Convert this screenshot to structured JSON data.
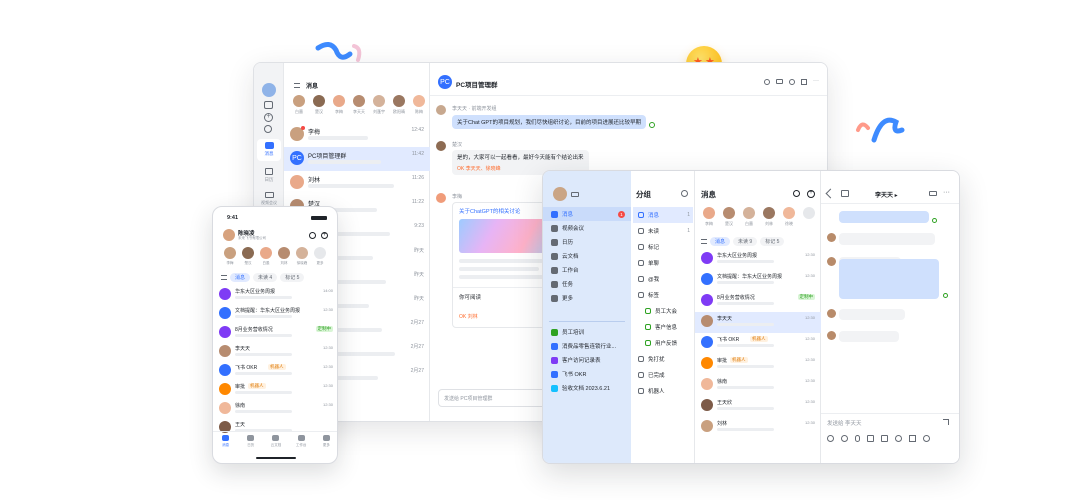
{
  "colors": {
    "accent": "#3370ff",
    "green": "#2ea121",
    "orange": "#ff8800",
    "red": "#f54a45",
    "purple": "#7f3bf5",
    "teal": "#14c0ff"
  },
  "desktop": {
    "rail": {
      "items": [
        {
          "label": "消息"
        },
        {
          "label": "日历"
        },
        {
          "label": "视频会议"
        }
      ]
    },
    "list": {
      "title": "消息",
      "top_avatars": [
        "白墨",
        "楚汉",
        "李梅",
        "李天天",
        "刘蓬宇",
        "欧阳晴",
        "陈梅"
      ],
      "items": [
        {
          "name": "李梅",
          "time": "12:42"
        },
        {
          "name": "PC项目管理群",
          "time": "11:42"
        },
        {
          "name": "刘林",
          "time": "11:26"
        },
        {
          "name": "楚汉",
          "time": "11:22"
        },
        {
          "name": "",
          "time": "9:23"
        },
        {
          "name": "",
          "time": "昨天"
        },
        {
          "name": "",
          "time": "昨天"
        },
        {
          "name": "",
          "time": "昨天"
        },
        {
          "name": "",
          "time": "2月27"
        },
        {
          "name": "",
          "time": "2月27"
        },
        {
          "name": "",
          "time": "2月27"
        }
      ]
    },
    "chat": {
      "title": "PC项目管理群",
      "msg1_sender": "李天天 · 前端开发组",
      "msg1_text": "关于Chat GPT的项目规划，我们尽快组织讨论，目前的项目进展还比较早期",
      "msg2_sender": "楚汉",
      "msg2_text": "是的，大家可以一起看看，最好今天能有个结论出来",
      "msg2_reaction": "OK 李天天、徐晓峰",
      "msg3_sender": "李梅",
      "doc_title": "关于ChatGPT的相关讨论",
      "doc_note": "你可阅读",
      "doc_reaction": "OK 刘林",
      "input_placeholder": "发送给 PC项目管理群"
    }
  },
  "phone": {
    "time": "9:41",
    "user": "陈晓凌",
    "company": "未来飞书有限公司",
    "top_avatars": [
      "李梅",
      "楚汉",
      "白墨",
      "刘林",
      "徐晓峰",
      "更多"
    ],
    "tabs": [
      "消息",
      "未读 4",
      "标记 5"
    ],
    "items": [
      {
        "name": "华东大区业务周报",
        "time": "14:00",
        "tag": ""
      },
      {
        "name": "文档提醒：华东大区业务周报",
        "time": "12:30",
        "tag": ""
      },
      {
        "name": "8月业务营收情况",
        "time": "",
        "tag": "定制中"
      },
      {
        "name": "李天天",
        "time": "12:30",
        "tag": ""
      },
      {
        "name": "飞书 OKR",
        "time": "12:30",
        "tag": "机器人"
      },
      {
        "name": "审批",
        "time": "12:30",
        "tag": "机器人"
      },
      {
        "name": "徐南",
        "time": "12:30",
        "tag": ""
      },
      {
        "name": "王天",
        "time": "",
        "tag": ""
      }
    ],
    "bottom_nav": [
      "消息",
      "日历",
      "云文档",
      "工作台",
      "更多"
    ]
  },
  "tablet": {
    "nav": [
      "消息",
      "视频会议",
      "日历",
      "云文档",
      "工作台",
      "任务",
      "更多"
    ],
    "nav_badge": "1",
    "apps": [
      "员工培训",
      "消费品零售连锁行业...",
      "客户访问记录表",
      "飞书 OKR",
      "验收文档 2023.6.21"
    ],
    "group_title": "分组",
    "groups": [
      {
        "label": "消息",
        "count": "1"
      },
      {
        "label": "未读",
        "count": "1"
      },
      {
        "label": "标记",
        "count": ""
      },
      {
        "label": "单聊",
        "count": ""
      },
      {
        "label": "@我",
        "count": ""
      },
      {
        "label": "标签",
        "count": ""
      },
      {
        "label": "员工大会",
        "count": ""
      },
      {
        "label": "客户信息",
        "count": ""
      },
      {
        "label": "用户反馈",
        "count": ""
      },
      {
        "label": "免打扰",
        "count": ""
      },
      {
        "label": "已完成",
        "count": ""
      },
      {
        "label": "机器人",
        "count": ""
      }
    ],
    "msg_title": "消息",
    "top_avatars": [
      "李梅",
      "楚汉",
      "白墨",
      "刘林",
      "徐晓"
    ],
    "tabs": [
      "消息",
      "未读 9",
      "标记 5"
    ],
    "items": [
      {
        "name": "华东大区业务周报",
        "time": "12:30",
        "tag": ""
      },
      {
        "name": "文档提醒：华东大区业务周报",
        "time": "12:30",
        "tag": ""
      },
      {
        "name": "8月业务营收情况",
        "time": "",
        "tag": "定制中"
      },
      {
        "name": "李天天",
        "time": "12:30",
        "tag": ""
      },
      {
        "name": "飞书 OKR",
        "time": "12:30",
        "tag": "机器人"
      },
      {
        "name": "审批",
        "time": "12:30",
        "tag": "机器人"
      },
      {
        "name": "徐南",
        "time": "12:30",
        "tag": ""
      },
      {
        "name": "王天欣",
        "time": "12:30",
        "tag": ""
      },
      {
        "name": "刘林",
        "time": "12:30",
        "tag": ""
      }
    ],
    "chat_title": "李天天 ▸",
    "input_placeholder": "发送给 李天天"
  }
}
